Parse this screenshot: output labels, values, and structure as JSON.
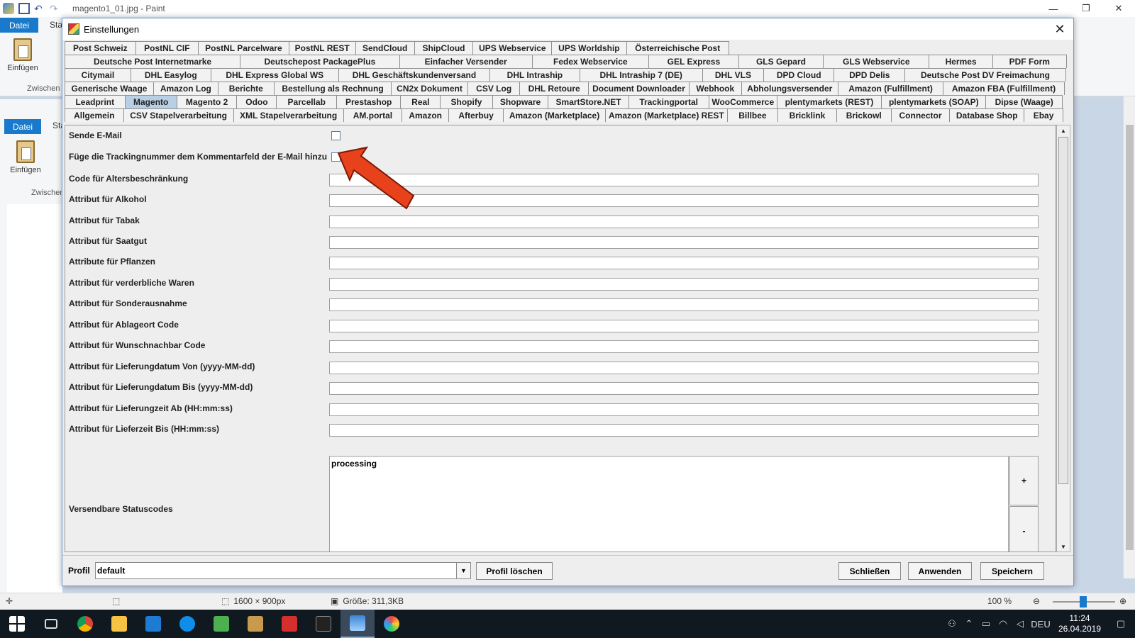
{
  "paint": {
    "title": "magento1_01.jpg - Paint",
    "tab_file": "Datei",
    "tab_start": "Sta",
    "paste_label": "Einfügen",
    "group_label": "Zwischen",
    "status_size": "1600 × 900px",
    "status_filesize": "Größe: 311,3KB",
    "zoom": "100 %"
  },
  "dialog": {
    "title": "Einstellungen",
    "tab_rows": [
      [
        "Post Schweiz",
        "PostNL CIF",
        "PostNL Parcelware",
        "PostNL REST",
        "SendCloud",
        "ShipCloud",
        "UPS Webservice",
        "UPS Worldship",
        "Österreichische Post"
      ],
      [
        "Deutsche Post Internetmarke",
        "Deutschepost PackagePlus",
        "Einfacher Versender",
        "Fedex Webservice",
        "GEL Express",
        "GLS Gepard",
        "GLS Webservice",
        "Hermes",
        "PDF Form"
      ],
      [
        "Citymail",
        "DHL Easylog",
        "DHL Express Global WS",
        "DHL Geschäftskundenversand",
        "DHL Intraship",
        "DHL Intraship 7 (DE)",
        "DHL VLS",
        "DPD Cloud",
        "DPD Delis",
        "Deutsche Post DV Freimachung"
      ],
      [
        "Generische Waage",
        "Amazon Log",
        "Berichte",
        "Bestellung als Rechnung",
        "CN2x Dokument",
        "CSV Log",
        "DHL Retoure",
        "Document Downloader",
        "Webhook",
        "Abholungsversender",
        "Amazon (Fulfillment)",
        "Amazon FBA (Fulfillment)"
      ],
      [
        "Leadprint",
        "Magento",
        "Magento 2",
        "Odoo",
        "Parcellab",
        "Prestashop",
        "Real",
        "Shopify",
        "Shopware",
        "SmartStore.NET",
        "Trackingportal",
        "WooCommerce",
        "plentymarkets (REST)",
        "plentymarkets (SOAP)",
        "Dipse (Waage)"
      ],
      [
        "Allgemein",
        "CSV Stapelverarbeitung",
        "XML Stapelverarbeitung",
        "AM.portal",
        "Amazon",
        "Afterbuy",
        "Amazon (Marketplace)",
        "Amazon (Marketplace) REST",
        "Billbee",
        "Bricklink",
        "Brickowl",
        "Connector",
        "Database Shop",
        "Ebay"
      ]
    ],
    "selected_tab": "Magento",
    "fields": {
      "send_email": "Sende E-Mail",
      "tracking_comment": "Füge die Trackingnummer dem Kommentarfeld der E-Mail hinzu",
      "age_code": "Code für Altersbeschränkung",
      "attr_alcohol": "Attribut für Alkohol",
      "attr_tobacco": "Attribut für Tabak",
      "attr_seeds": "Attribut für Saatgut",
      "attr_plants": "Attribute für Pflanzen",
      "attr_perishable": "Attribut für verderbliche Waren",
      "attr_special": "Attribut für Sonderausnahme",
      "attr_dropoff": "Attribut für Ablageort Code",
      "attr_neighbour": "Attribut für Wunschnachbar Code",
      "attr_date_from": "Attribut für Lieferungdatum Von (yyyy-MM-dd)",
      "attr_date_to": "Attribut für Lieferungdatum Bis (yyyy-MM-dd)",
      "attr_time_from": "Attribut für Lieferungzeit Ab (HH:mm:ss)",
      "attr_time_to": "Attribut für Lieferzeit Bis (HH:mm:ss)",
      "status_codes": "Versendbare Statuscodes",
      "status_value": "processing",
      "plus": "+",
      "minus": "-"
    },
    "footer": {
      "profile_label": "Profil",
      "profile_value": "default",
      "delete_profile": "Profil löschen",
      "close": "Schließen",
      "apply": "Anwenden",
      "save": "Speichern"
    }
  },
  "taskbar": {
    "lang": "DEU",
    "time": "11:24",
    "date": "26.04.2019"
  },
  "colors": {
    "accent": "#1979ca",
    "selected_tab": "#b8cfe5",
    "arrow": "#e8421c"
  }
}
